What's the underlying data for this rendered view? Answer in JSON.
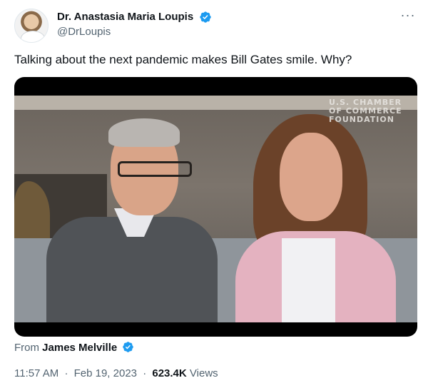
{
  "author": {
    "display_name": "Dr. Anastasia Maria Loupis",
    "handle": "@DrLoupis",
    "verified": true
  },
  "tweet": {
    "text": "Talking about the next pandemic makes Bill Gates smile. Why?"
  },
  "media": {
    "watermark_lines": [
      "U.S. CHAMBER",
      "OF COMMERCE",
      "FOUNDATION"
    ]
  },
  "attribution": {
    "prefix": "From",
    "name": "James Melville",
    "verified": true
  },
  "meta": {
    "time": "11:57 AM",
    "separator": "·",
    "date": "Feb 19, 2023",
    "views_count": "623.4K",
    "views_label": "Views"
  },
  "icons": {
    "more": "more-horizontal-icon",
    "verified": "verified-badge-icon"
  },
  "colors": {
    "verified": "#1d9bf0",
    "secondary_text": "#536471",
    "primary_text": "#0f1419"
  }
}
